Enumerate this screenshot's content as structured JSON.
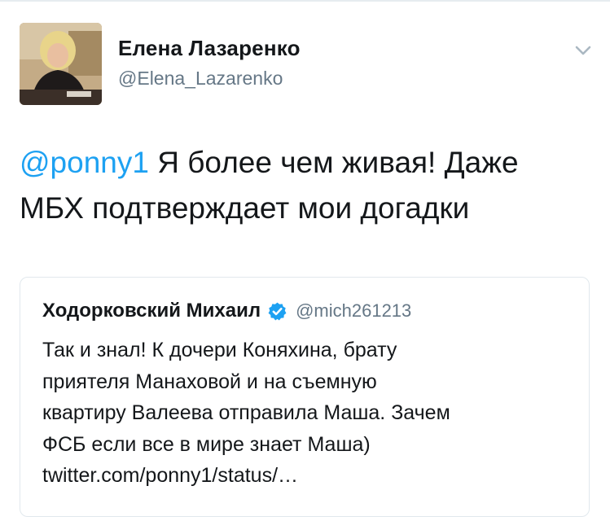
{
  "tweet": {
    "author_name": "Елена Лазаренко",
    "author_handle": "@Elena_Lazarenko",
    "mention": "@ponny1",
    "text_line1_rest": " Я более чем живая! Даже",
    "text_line2": "МБХ подтверждает мои догадки"
  },
  "quoted_tweet": {
    "author_name": "Ходорковский Михаил",
    "author_handle": "@mich261213",
    "lines": [
      "Так и знал! К дочери Коняхина, брату",
      "приятеля Манаховой и на съемную",
      "квартиру Валеева отправила Маша. Зачем",
      "ФСБ если все в мире знает Маша)",
      "twitter.com/ponny1/status/…"
    ]
  },
  "icons": {
    "menu": "chevron-down-icon",
    "verified": "verified-badge-icon",
    "avatar": "profile-photo"
  },
  "colors": {
    "link": "#1da1f2",
    "secondary_text": "#657786",
    "border": "#e1e8ed",
    "verified": "#1da1f2"
  }
}
